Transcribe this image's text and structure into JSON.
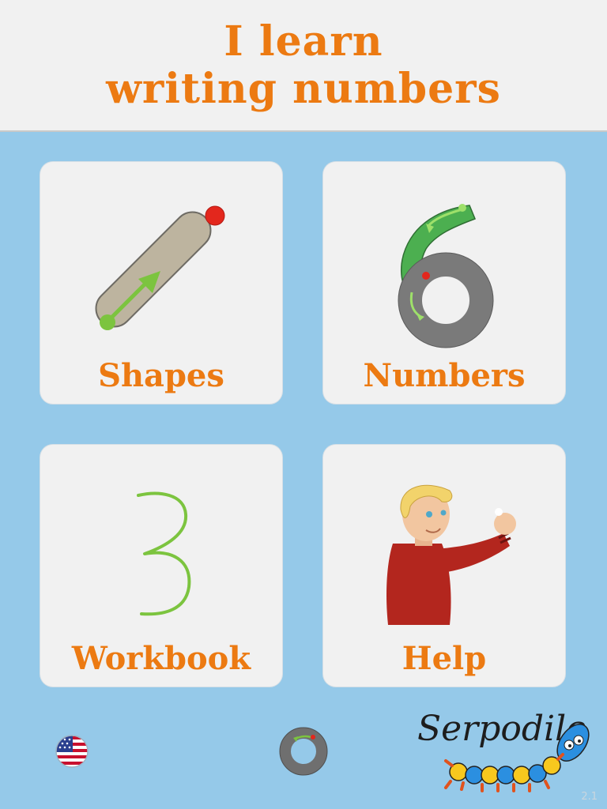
{
  "header": {
    "title_line1": "I learn",
    "title_line2": "writing numbers"
  },
  "menu": {
    "shapes_label": "Shapes",
    "numbers_label": "Numbers",
    "workbook_label": "Workbook",
    "help_label": "Help"
  },
  "footer": {
    "logo_text": "Serpodile",
    "version": "2.1",
    "language_icon": "us-flag-icon",
    "tracing_icon": "tracing-ring-icon"
  },
  "colors": {
    "background": "#95c9e9",
    "accent_orange": "#ec7a12",
    "tile": "#f1f1f1"
  }
}
